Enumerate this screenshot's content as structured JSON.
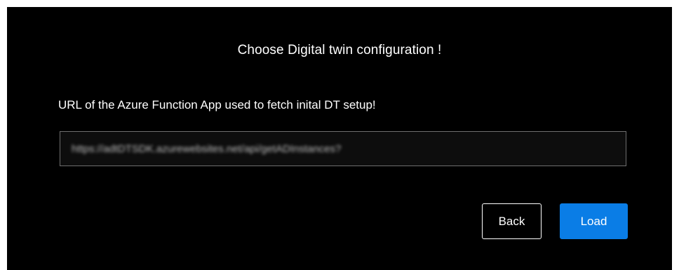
{
  "dialog": {
    "title": "Choose Digital twin configuration !",
    "url_field": {
      "label": "URL of the Azure Function App used to fetch inital DT setup!",
      "value": "https://adtDTSDK.azurewebsites.net/api/getADInstances?"
    },
    "buttons": {
      "back_label": "Back",
      "load_label": "Load"
    }
  },
  "colors": {
    "dialog_background": "#000000",
    "primary_button": "#0a7de6",
    "text": "#ffffff"
  }
}
